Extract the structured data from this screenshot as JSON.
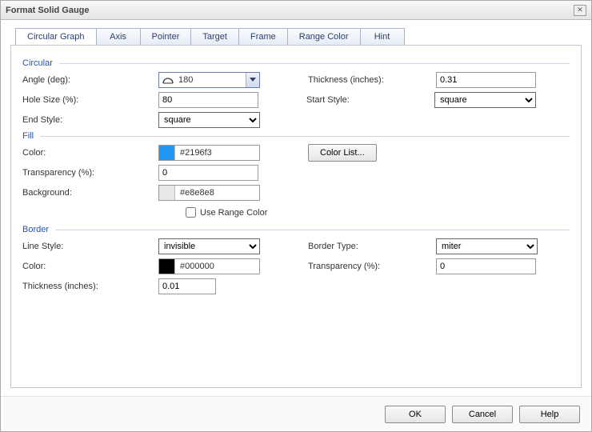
{
  "dialog": {
    "title": "Format Solid Gauge"
  },
  "tabs": {
    "items": [
      {
        "label": "Circular Graph"
      },
      {
        "label": "Axis"
      },
      {
        "label": "Pointer"
      },
      {
        "label": "Target"
      },
      {
        "label": "Frame"
      },
      {
        "label": "Range Color"
      },
      {
        "label": "Hint"
      }
    ],
    "active_index": 0
  },
  "sections": {
    "circular": {
      "title": "Circular",
      "angle": {
        "label": "Angle (deg):",
        "value": "180"
      },
      "thickness": {
        "label": "Thickness (inches):",
        "value": "0.31"
      },
      "hole_size": {
        "label": "Hole Size (%):",
        "value": "80"
      },
      "start_style": {
        "label": "Start Style:",
        "value": "square"
      },
      "end_style": {
        "label": "End Style:",
        "value": "square"
      }
    },
    "fill": {
      "title": "Fill",
      "color": {
        "label": "Color:",
        "hex": "#2196f3"
      },
      "color_list_btn": "Color List...",
      "transparency": {
        "label": "Transparency (%):",
        "value": "0"
      },
      "background": {
        "label": "Background:",
        "hex": "#e8e8e8"
      },
      "use_range_color": {
        "label": "Use Range Color",
        "checked": false
      }
    },
    "border": {
      "title": "Border",
      "line_style": {
        "label": "Line Style:",
        "value": "invisible"
      },
      "border_type": {
        "label": "Border Type:",
        "value": "miter"
      },
      "color": {
        "label": "Color:",
        "hex": "#000000"
      },
      "transparency": {
        "label": "Transparency (%):",
        "value": "0"
      },
      "thickness": {
        "label": "Thickness (inches):",
        "value": "0.01"
      }
    }
  },
  "footer": {
    "ok": "OK",
    "cancel": "Cancel",
    "help": "Help"
  }
}
